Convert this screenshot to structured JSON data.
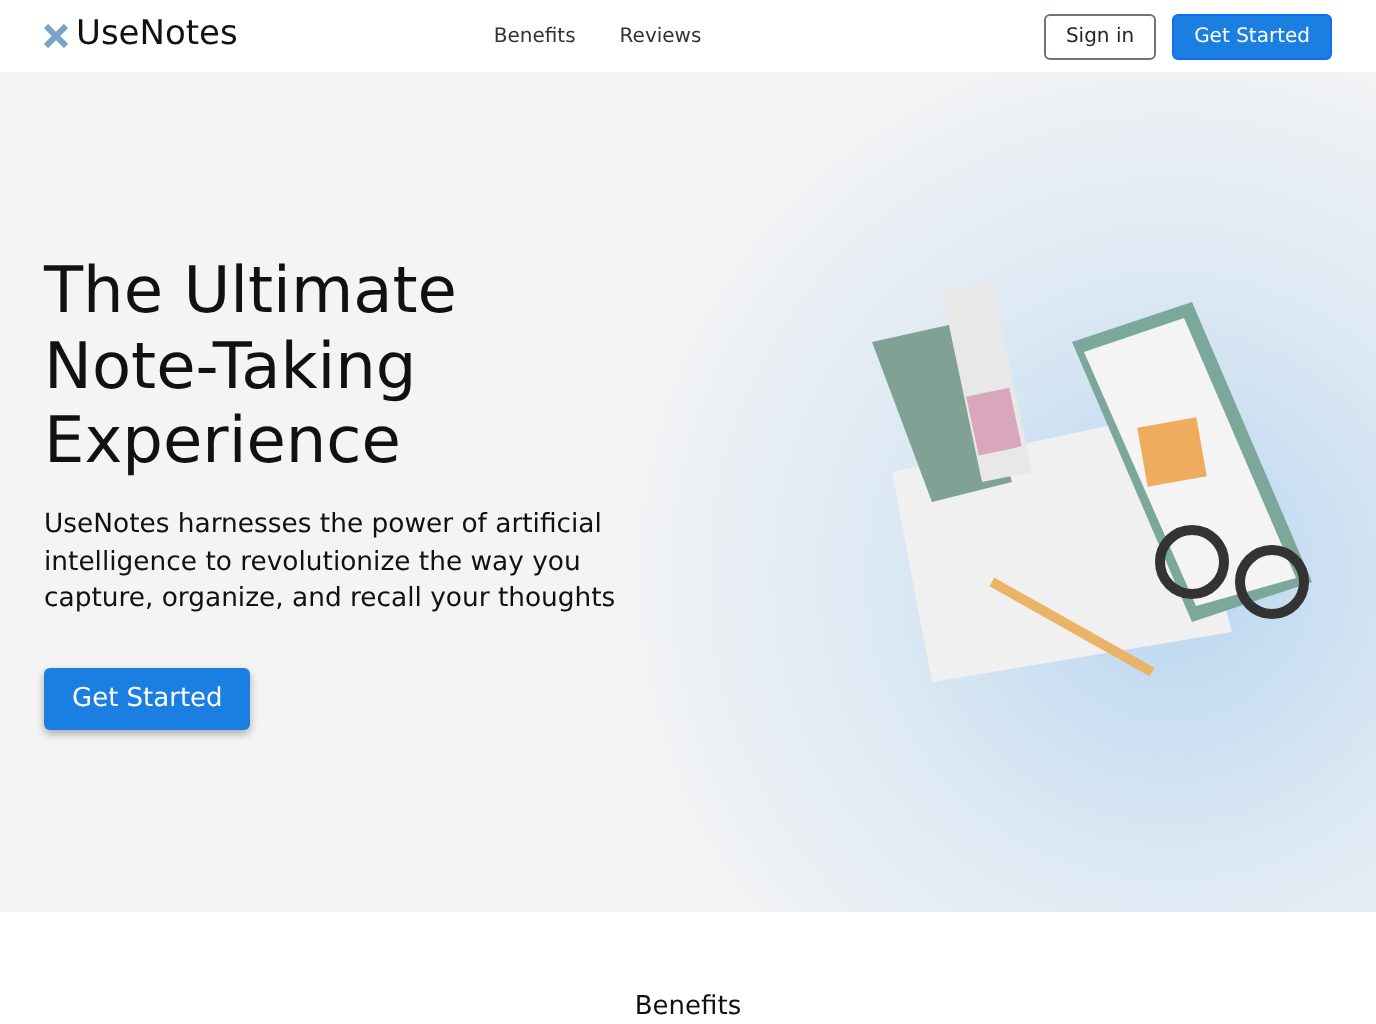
{
  "navbar": {
    "brand": "UseNotes",
    "links": [
      {
        "label": "Benefits"
      },
      {
        "label": "Reviews"
      }
    ],
    "sign_in": "Sign in",
    "get_started": "Get Started"
  },
  "hero": {
    "title": "The Ultimate Note-Taking Experience",
    "subtitle": "UseNotes harnesses the power of artificial intelligence to revolutionize the way you capture, organize, and recall your thoughts",
    "button": "Get Started"
  },
  "section": {
    "title": "Benefits"
  }
}
